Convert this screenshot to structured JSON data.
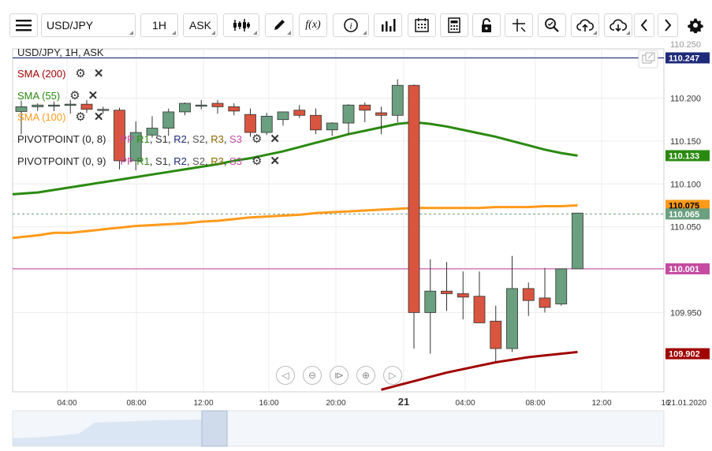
{
  "toolbar": {
    "symbol": "USD/JPY",
    "timeframe": "1H",
    "price_type": "ASK",
    "icons": [
      "menu-icon",
      "candlestick-type-icon",
      "draw-pencil-icon",
      "function-icon",
      "info-icon",
      "bar-chart-icon",
      "calendar-icon",
      "calculator-icon",
      "lock-icon",
      "crosshair-icon",
      "zoom-icon",
      "cloud-upload-icon",
      "cloud-download-icon",
      "chevron-left-icon",
      "chevron-right-icon",
      "gear-icon"
    ],
    "function_label": "f(x)"
  },
  "legend": {
    "header": "USD/JPY, 1H, ASK",
    "sma200": "SMA (200)",
    "sma55": "SMA (55)",
    "sma100": "SMA (100)",
    "pivot1": "PIVOTPOINT (0, 8)",
    "pivot2": "PIVOTPOINT (0, 9)",
    "pp_components": [
      "PP",
      "R1",
      "S1",
      "R2",
      "S2",
      "R3",
      "S3"
    ]
  },
  "colors": {
    "up": "#6a9f7f",
    "down": "#d9553f",
    "sma55": "#2a8a10",
    "sma100": "#ff9a1a",
    "sma200": "#a00000",
    "pivot": "#c44ba0",
    "blue_line": "#1f2a7a",
    "pp": "#c44ba0",
    "r1": "#2a8a10",
    "s1": "#333333",
    "r2": "#1f2a7a",
    "s2": "#555555",
    "r3": "#8a6a00",
    "s3": "#c44ba0"
  },
  "chart_data": {
    "type": "candlestick",
    "ylim": [
      109.8575,
      110.2575
    ],
    "y_ticks": [
      110.2,
      110.15,
      110.1,
      110.05,
      109.95
    ],
    "y_tick_labels": [
      "110.200",
      "110.150",
      "110.100",
      "110.050",
      "109.950"
    ],
    "top_partial_label": "110.250",
    "x_ticks": [
      "04:00",
      "08:00",
      "12:00",
      "16:00",
      "20:00",
      "21",
      "04:00",
      "08:00",
      "12:00",
      "16"
    ],
    "x_date_label": "21.01.2020",
    "price_markers": [
      {
        "label": "110.247",
        "value": 110.247,
        "color": "#1f2a7a",
        "text": "#ffffff"
      },
      {
        "label": "110.133",
        "value": 110.133,
        "color": "#2a8a10",
        "text": "#ffffff"
      },
      {
        "label": "110.075",
        "value": 110.075,
        "color": "#ff9a1a",
        "text": "#000000"
      },
      {
        "label": "110.065",
        "value": 110.065,
        "color": "#6a9f7f",
        "text": "#ffffff"
      },
      {
        "label": "110.001",
        "value": 110.001,
        "color": "#c44ba0",
        "text": "#ffffff"
      },
      {
        "label": "109.902",
        "value": 109.902,
        "color": "#a00000",
        "text": "#ffffff"
      }
    ],
    "candles": [
      {
        "o": 110.1845,
        "h": 110.197,
        "l": 110.158,
        "c": 110.19
      },
      {
        "o": 110.19,
        "h": 110.194,
        "l": 110.185,
        "c": 110.192
      },
      {
        "o": 110.191,
        "h": 110.196,
        "l": 110.185,
        "c": 110.192
      },
      {
        "o": 110.192,
        "h": 110.198,
        "l": 110.182,
        "c": 110.193
      },
      {
        "o": 110.193,
        "h": 110.198,
        "l": 110.183,
        "c": 110.187
      },
      {
        "o": 110.187,
        "h": 110.19,
        "l": 110.182,
        "c": 110.187
      },
      {
        "o": 110.186,
        "h": 110.189,
        "l": 110.117,
        "c": 110.127
      },
      {
        "o": 110.127,
        "h": 110.173,
        "l": 110.116,
        "c": 110.16
      },
      {
        "o": 110.157,
        "h": 110.179,
        "l": 110.154,
        "c": 110.165
      },
      {
        "o": 110.165,
        "h": 110.188,
        "l": 110.156,
        "c": 110.184
      },
      {
        "o": 110.184,
        "h": 110.195,
        "l": 110.18,
        "c": 110.194
      },
      {
        "o": 110.192,
        "h": 110.198,
        "l": 110.187,
        "c": 110.192
      },
      {
        "o": 110.194,
        "h": 110.198,
        "l": 110.182,
        "c": 110.19
      },
      {
        "o": 110.19,
        "h": 110.194,
        "l": 110.18,
        "c": 110.185
      },
      {
        "o": 110.181,
        "h": 110.188,
        "l": 110.155,
        "c": 110.16
      },
      {
        "o": 110.16,
        "h": 110.183,
        "l": 110.157,
        "c": 110.179
      },
      {
        "o": 110.175,
        "h": 110.183,
        "l": 110.168,
        "c": 110.184
      },
      {
        "o": 110.186,
        "h": 110.192,
        "l": 110.177,
        "c": 110.18
      },
      {
        "o": 110.18,
        "h": 110.188,
        "l": 110.158,
        "c": 110.163
      },
      {
        "o": 110.163,
        "h": 110.172,
        "l": 110.156,
        "c": 110.171
      },
      {
        "o": 110.171,
        "h": 110.193,
        "l": 110.158,
        "c": 110.192
      },
      {
        "o": 110.192,
        "h": 110.195,
        "l": 110.172,
        "c": 110.186
      },
      {
        "o": 110.183,
        "h": 110.19,
        "l": 110.158,
        "c": 110.18
      },
      {
        "o": 110.18,
        "h": 110.222,
        "l": 110.172,
        "c": 110.215
      },
      {
        "o": 110.215,
        "h": 110.216,
        "l": 109.908,
        "c": 109.95
      },
      {
        "o": 109.95,
        "h": 110.012,
        "l": 109.902,
        "c": 109.975
      },
      {
        "o": 109.975,
        "h": 110.009,
        "l": 109.952,
        "c": 109.972
      },
      {
        "o": 109.972,
        "h": 109.998,
        "l": 109.942,
        "c": 109.968
      },
      {
        "o": 109.969,
        "h": 109.998,
        "l": 109.938,
        "c": 109.938
      },
      {
        "o": 109.94,
        "h": 109.958,
        "l": 109.892,
        "c": 109.908
      },
      {
        "o": 109.908,
        "h": 110.016,
        "l": 109.904,
        "c": 109.978
      },
      {
        "o": 109.978,
        "h": 109.985,
        "l": 109.946,
        "c": 109.964
      },
      {
        "o": 109.967,
        "h": 110.002,
        "l": 109.95,
        "c": 109.956
      },
      {
        "o": 109.96,
        "h": 110.001,
        "l": 109.958,
        "c": 110.001
      },
      {
        "o": 110.001,
        "h": 110.066,
        "l": 110.001,
        "c": 110.066
      }
    ],
    "sma55": [
      110.088,
      110.09,
      110.093,
      110.096,
      110.099,
      110.102,
      110.105,
      110.108,
      110.111,
      110.114,
      110.117,
      110.12,
      110.123,
      110.127,
      110.13,
      110.134,
      110.138,
      110.143,
      110.148,
      110.153,
      110.158,
      110.162,
      110.166,
      110.17,
      110.172,
      110.17,
      110.167,
      110.163,
      110.159,
      110.155,
      110.15,
      110.145,
      110.14,
      110.136,
      110.133
    ],
    "sma100": [
      110.037,
      110.04,
      110.043,
      110.043,
      110.045,
      110.047,
      110.049,
      110.051,
      110.052,
      110.053,
      110.054,
      110.056,
      110.057,
      110.059,
      110.061,
      110.062,
      110.063,
      110.064,
      110.066,
      110.067,
      110.068,
      110.069,
      110.07,
      110.071,
      110.072,
      110.072,
      110.072,
      110.072,
      110.072,
      110.073,
      110.073,
      110.073,
      110.074,
      110.074,
      110.075
    ],
    "sma200": [
      null,
      null,
      null,
      null,
      null,
      null,
      null,
      null,
      null,
      null,
      null,
      null,
      null,
      null,
      null,
      null,
      null,
      null,
      null,
      null,
      null,
      null,
      109.86,
      109.865,
      109.87,
      109.875,
      109.88,
      109.884,
      109.888,
      109.892,
      109.895,
      109.898,
      109.9,
      109.902,
      109.904
    ],
    "pivot_level": 110.001,
    "blue_level": 110.247,
    "dashed_level": 110.065
  }
}
